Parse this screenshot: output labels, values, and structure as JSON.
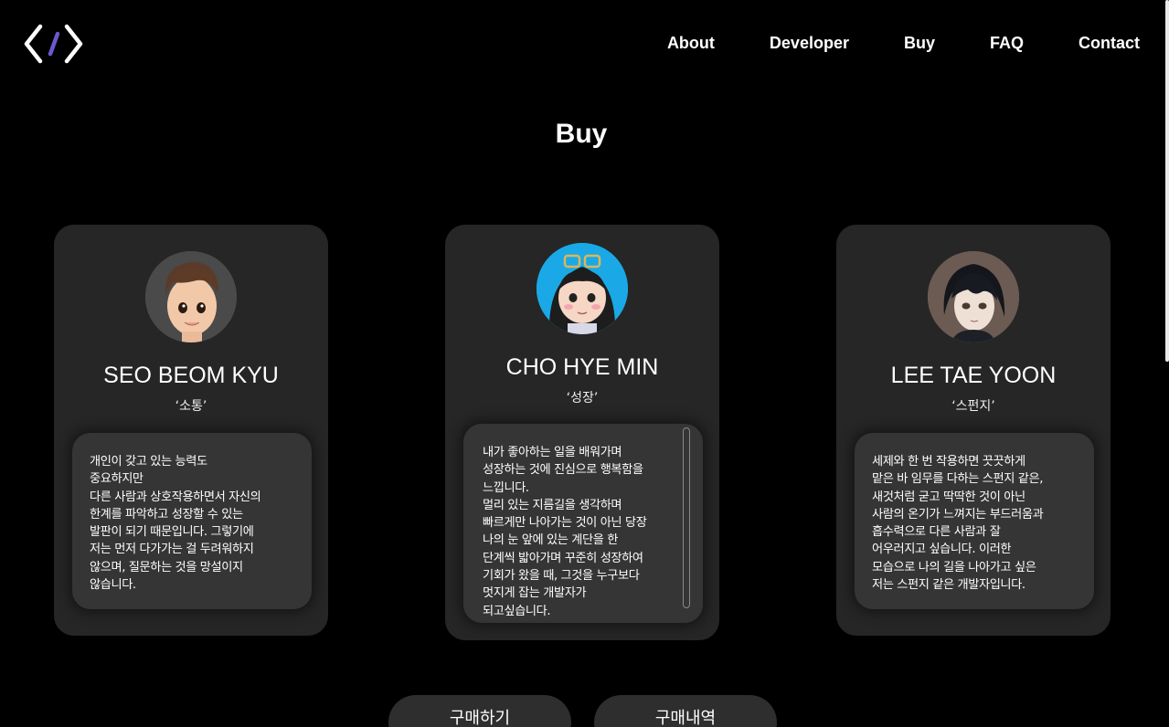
{
  "header": {
    "logo_icon": "code-brackets-icon",
    "nav": [
      {
        "label": "About"
      },
      {
        "label": "Developer"
      },
      {
        "label": "Buy"
      },
      {
        "label": "FAQ"
      },
      {
        "label": "Contact"
      }
    ]
  },
  "section": {
    "title": "Buy"
  },
  "members": [
    {
      "name": "SEO BEOM KYU",
      "tag": "‘소통’",
      "description": "개인이 갖고 있는 능력도\n중요하지만\n다른 사람과 상호작용하면서 자신의\n한계를 파악하고 성장할 수 있는\n발판이 되기 때문입니다. 그렇기에\n저는 먼저 다가가는 걸 두려워하지\n않으며, 질문하는 것을 망설이지\n않습니다."
    },
    {
      "name": "CHO HYE MIN",
      "tag": "‘성장’",
      "description": "내가 좋아하는 일을 배워가며\n성장하는 것에 진심으로 행복함을\n느낍니다.\n멀리 있는 지름길을 생각하며\n빠르게만 나아가는 것이 아닌 당장\n나의 눈 앞에 있는 계단을 한\n단계씩 밟아가며 꾸준히 성장하여\n기회가 왔을 때, 그것을 누구보다\n멋지게 잡는 개발자가\n되고싶습니다."
    },
    {
      "name": "LEE TAE YOON",
      "tag": "‘스펀지’",
      "description": "세제와 한 번 작용하면 끗끗하게\n맡은 바 임무를 다하는 스펀지 같은,\n새것처럼 굳고 딱딱한 것이 아닌\n사람의 온기가 느껴지는 부드러움과\n흡수력으로 다른 사람과 잘\n어우러지고 싶습니다. 이러한\n모습으로 나의 길을 나아가고 싶은\n저는 스펀지 같은 개발자입니다."
    }
  ],
  "buttons": {
    "buy_label": "구매하기",
    "history_label": "구매내역"
  },
  "colors": {
    "background": "#000000",
    "card": "#262626",
    "desc_box": "#353535",
    "button": "#2e2e2e",
    "logo_slash": "#6a5acd"
  }
}
